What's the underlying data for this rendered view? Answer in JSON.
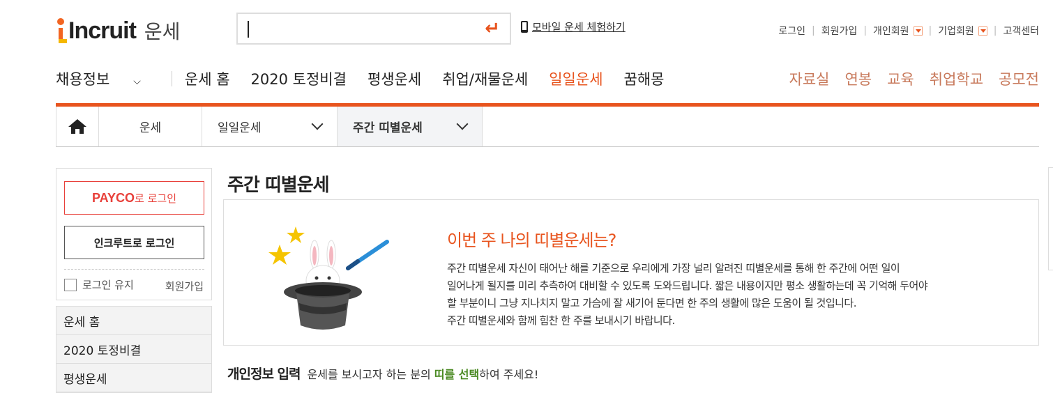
{
  "header": {
    "logo_text": "Incruit",
    "logo_sub": "운세",
    "search": {
      "value": "",
      "placeholder": ""
    },
    "mobile_link": "모바일 운세 체험하기",
    "util_links": [
      "로그인",
      "회원가입",
      "개인회원",
      "기업회원",
      "고객센터"
    ]
  },
  "gnb": {
    "left": [
      "채용정보",
      "운세 홈",
      "2020 토정비결",
      "평생운세",
      "취업/재물운세",
      "일일운세",
      "꿈해몽"
    ],
    "active": "일일운세",
    "right": [
      "자료실",
      "연봉",
      "교육",
      "취업학교",
      "공모전"
    ]
  },
  "breadcrumb": {
    "c1": "운세",
    "c2": "일일운세",
    "c3": "주간 띠별운세"
  },
  "login": {
    "payco_brand": "PAYCO",
    "payco_suffix": "로 로그인",
    "incruit_login": "인크루트로 로그인",
    "keep_login": "로그인 유지",
    "join": "회원가입"
  },
  "side_menu": [
    "운세 홈",
    "2020 토정비결",
    "평생운세"
  ],
  "main": {
    "title": "주간 띠별운세",
    "intro_heading": "이번 주 나의 띠별운세는?",
    "intro_lines": [
      "주간 띠별운세 자신이 태어난 해를 기준으로 우리에게 가장 널리 알려진 띠별운세를 통해 한 주간에 어떤 일이",
      "일어나게 될지를 미리 추측하여 대비할 수 있도록 도와드립니다. 짧은 내용이지만 평소 생활하는데 꼭 기억해 두어야",
      "할 부분이니 그냥 지나치지 말고 가슴에 잘 새기어 둔다면 한 주의 생활에 많은 도움이 될 것입니다.",
      "주간 띠별운세와 함께 힘찬 한 주를 보내시기 바랍니다."
    ],
    "info_title": "개인정보 입력",
    "info_desc_pre": "운세를 보시고자 하는 분의 ",
    "info_desc_hl": "띠를 선택",
    "info_desc_post": "하여 주세요!"
  },
  "colors": {
    "accent": "#e8541e",
    "highlight_green": "#4b8a23",
    "payco_red": "#e8403a"
  }
}
